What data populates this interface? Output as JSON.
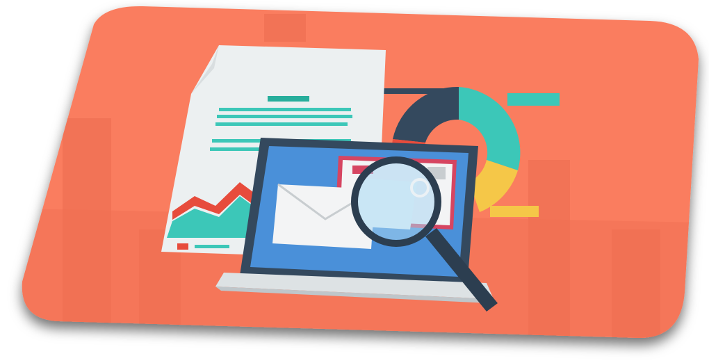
{
  "illustration": {
    "subject": "email-analysis",
    "palette": {
      "background": "#FA7D5E",
      "background_shade": "#F27356",
      "paper": "#ECF0F1",
      "paper_fold": "#D9DEE0",
      "teal": "#3CC7B8",
      "teal_dark": "#27AE9C",
      "navy": "#34495E",
      "screen": "#4A90D9",
      "red": "#E74C3C",
      "yellow": "#F5C748",
      "laptop_body": "#DDE2E4",
      "envelope": "#F3F4F5",
      "stamp_red": "#D64561",
      "lens": "#A9D6F0"
    },
    "icons": [
      "document-icon",
      "donut-chart-icon",
      "laptop-icon",
      "envelope-icon",
      "magnifier-icon"
    ]
  }
}
